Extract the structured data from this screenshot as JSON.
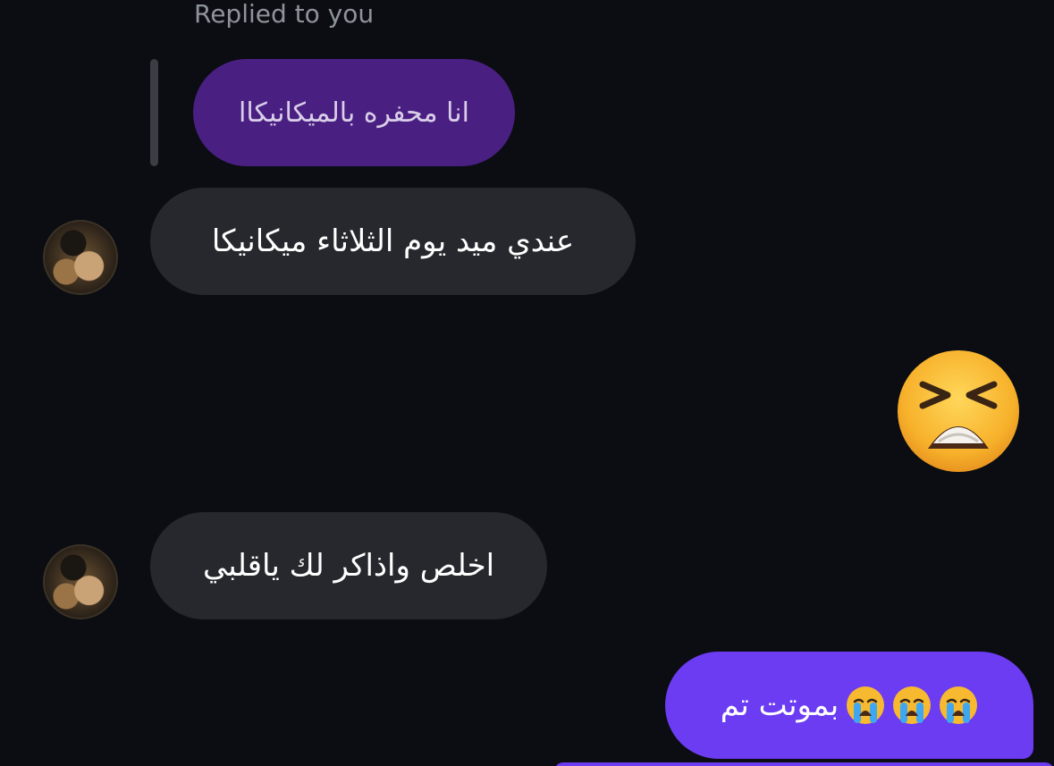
{
  "reply": {
    "label": "Replied to you",
    "quoted_text": "انا محفره بالميكانيكاا"
  },
  "messages": [
    {
      "direction": "incoming",
      "text": "عندي ميد يوم الثلاثاء ميكانيكا"
    },
    {
      "direction": "outgoing",
      "emoji": "tired-face-emoji"
    },
    {
      "direction": "incoming",
      "text": "اخلص واذاكر لك ياقلبي"
    },
    {
      "direction": "outgoing",
      "text": "بموتت تم",
      "emoji_suffix": "loudly-crying-face-emoji",
      "emoji_count": 3
    }
  ],
  "colors": {
    "background": "#0b0d12",
    "incoming_bubble": "#26282d",
    "outgoing_bubble": "#6b3cf2",
    "quoted_bubble": "#4a1f82"
  }
}
